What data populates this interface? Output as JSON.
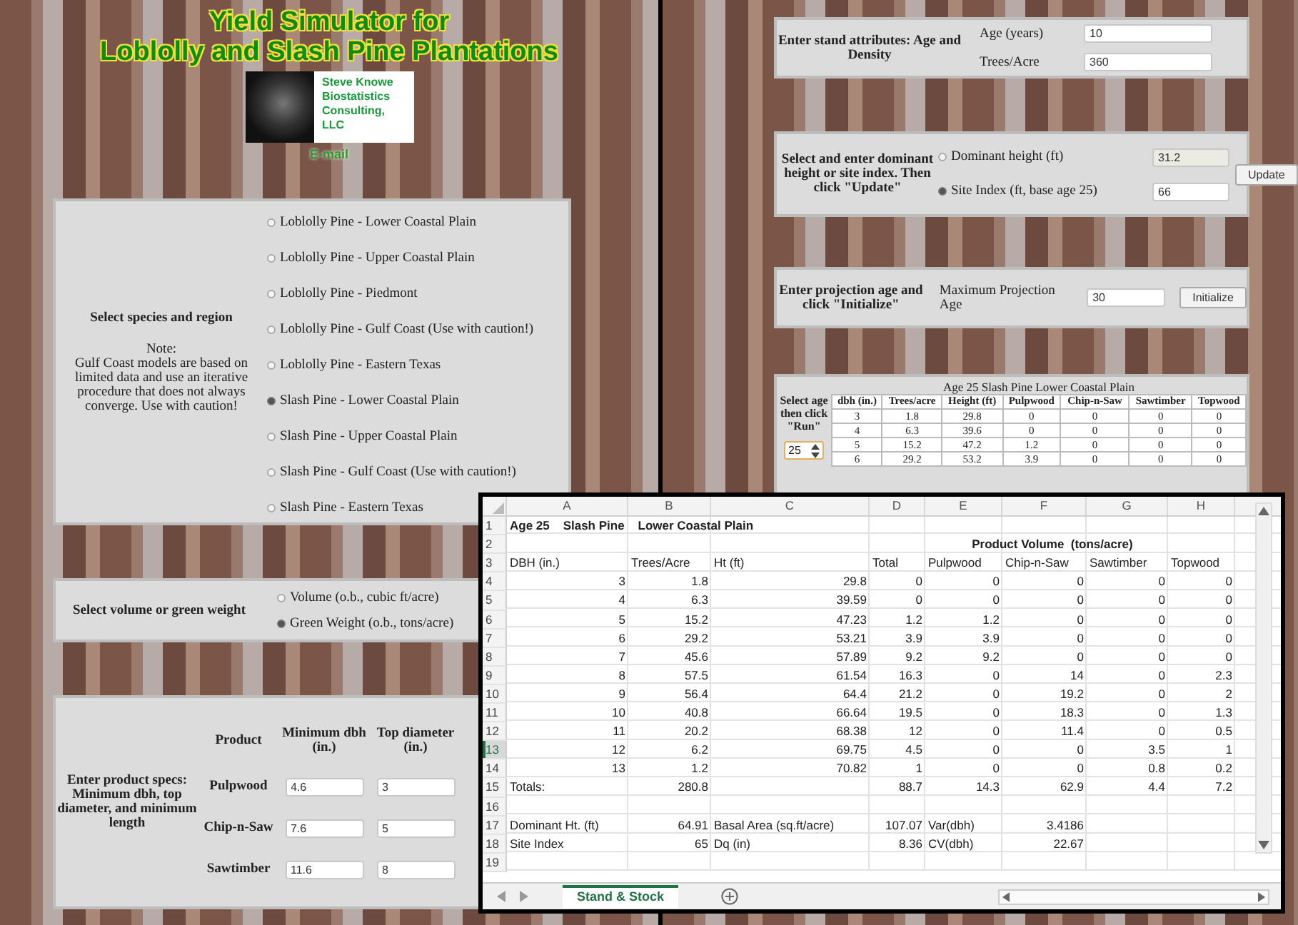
{
  "header": {
    "title_lines": [
      "Yield Simulator for",
      "Loblolly and Slash Pine Plantations"
    ],
    "logo_text": "Steve Knowe Biostatistics Consulting, LLC",
    "link": "E-mail"
  },
  "species": {
    "label": "Select species and region",
    "note_title": "Note:",
    "note": "Gulf Coast models are based on limited data and use an iterative procedure that does not always converge. Use with caution!",
    "options": [
      {
        "label": "Loblolly Pine - Lower Coastal Plain",
        "selected": false
      },
      {
        "label": "Loblolly Pine - Upper Coastal Plain",
        "selected": false
      },
      {
        "label": "Loblolly Pine - Piedmont",
        "selected": false
      },
      {
        "label": "Loblolly Pine - Gulf Coast (Use with caution!)",
        "selected": false
      },
      {
        "label": "Loblolly Pine - Eastern Texas",
        "selected": false
      },
      {
        "label": "Slash Pine - Lower Coastal Plain",
        "selected": true
      },
      {
        "label": "Slash Pine - Upper Coastal Plain",
        "selected": false
      },
      {
        "label": "Slash Pine - Gulf Coast (Use with caution!)",
        "selected": false
      },
      {
        "label": "Slash Pine - Eastern Texas",
        "selected": false
      }
    ]
  },
  "measure": {
    "label": "Select volume or green weight",
    "options": [
      {
        "label": "Volume (o.b., cubic ft/acre)",
        "selected": false
      },
      {
        "label": "Green Weight (o.b., tons/acre)",
        "selected": true
      }
    ]
  },
  "products": {
    "label": "Enter product specs: Minimum dbh, top diameter, and minimum length",
    "columns": [
      "Product",
      "Minimum dbh (in.)",
      "Top diameter (in.)"
    ],
    "rows": [
      {
        "name": "Pulpwood",
        "min_dbh": "4.6",
        "top_diameter": "3"
      },
      {
        "name": "Chip-n-Saw",
        "min_dbh": "7.6",
        "top_diameter": "5"
      },
      {
        "name": "Sawtimber",
        "min_dbh": "11.6",
        "top_diameter": "8"
      }
    ]
  },
  "stand": {
    "label": "Enter stand attributes: Age and Density",
    "fields": [
      {
        "label": "Age (years)",
        "value": "10"
      },
      {
        "label": "Trees/Acre",
        "value": "360"
      }
    ]
  },
  "site": {
    "label": "Select and enter dominant height or site index. Then click \"Update\"",
    "options": [
      {
        "label": "Dominant height (ft)",
        "value": "31.2",
        "selected": false
      },
      {
        "label": "Site Index (ft, base age 25)",
        "value": "66",
        "selected": true
      }
    ],
    "button": "Update"
  },
  "projection": {
    "label": "Enter projection age and click \"Initialize\"",
    "field_label": "Maximum Projection Age",
    "value": "30",
    "button": "Initialize"
  },
  "run": {
    "label": "Select age then click \"Run\"",
    "age": "25",
    "table_title": "Age 25 Slash Pine Lower Coastal Plain",
    "columns": [
      "dbh (in.)",
      "Trees/acre",
      "Height (ft)",
      "Pulpwood",
      "Chip-n-Saw",
      "Sawtimber",
      "Topwood"
    ],
    "rows": [
      [
        "3",
        "1.8",
        "29.8",
        "0",
        "0",
        "0",
        "0"
      ],
      [
        "4",
        "6.3",
        "39.6",
        "0",
        "0",
        "0",
        "0"
      ],
      [
        "5",
        "15.2",
        "47.2",
        "1.2",
        "0",
        "0",
        "0"
      ],
      [
        "6",
        "29.2",
        "53.2",
        "3.9",
        "0",
        "0",
        "0"
      ]
    ]
  },
  "spreadsheet": {
    "columns": [
      "A",
      "B",
      "C",
      "D",
      "E",
      "F",
      "G",
      "H"
    ],
    "rows": [
      {
        "number": "1",
        "selected": false,
        "cells": [
          {
            "kind": "title",
            "text": "Age 25    Slash Pine    Lower Coastal Plain"
          }
        ]
      },
      {
        "number": "2",
        "selected": false,
        "cells": [
          null,
          null,
          null,
          {
            "kind": "group",
            "text": "Product Volume  (tons/acre)"
          }
        ]
      },
      {
        "number": "3",
        "selected": false,
        "cells": [
          {
            "kind": "text",
            "text": "DBH (in.)"
          },
          {
            "kind": "text",
            "text": "Trees/Acre"
          },
          {
            "kind": "text",
            "text": "Ht (ft)"
          },
          {
            "kind": "text",
            "text": "Total"
          },
          {
            "kind": "text",
            "text": "Pulpwood"
          },
          {
            "kind": "text",
            "text": "Chip-n-Saw"
          },
          {
            "kind": "text",
            "text": "Sawtimber"
          },
          {
            "kind": "text",
            "text": "Topwood"
          }
        ]
      },
      {
        "number": "4",
        "selected": false,
        "values": [
          "3",
          "1.8",
          "29.8",
          "0",
          "0",
          "0",
          "0",
          "0"
        ]
      },
      {
        "number": "5",
        "selected": false,
        "values": [
          "4",
          "6.3",
          "39.59",
          "0",
          "0",
          "0",
          "0",
          "0"
        ]
      },
      {
        "number": "6",
        "selected": false,
        "values": [
          "5",
          "15.2",
          "47.23",
          "1.2",
          "1.2",
          "0",
          "0",
          "0"
        ]
      },
      {
        "number": "7",
        "selected": false,
        "values": [
          "6",
          "29.2",
          "53.21",
          "3.9",
          "3.9",
          "0",
          "0",
          "0"
        ]
      },
      {
        "number": "8",
        "selected": false,
        "values": [
          "7",
          "45.6",
          "57.89",
          "9.2",
          "9.2",
          "0",
          "0",
          "0"
        ]
      },
      {
        "number": "9",
        "selected": false,
        "values": [
          "8",
          "57.5",
          "61.54",
          "16.3",
          "0",
          "14",
          "0",
          "2.3"
        ]
      },
      {
        "number": "10",
        "selected": false,
        "values": [
          "9",
          "56.4",
          "64.4",
          "21.2",
          "0",
          "19.2",
          "0",
          "2"
        ]
      },
      {
        "number": "11",
        "selected": false,
        "values": [
          "10",
          "40.8",
          "66.64",
          "19.5",
          "0",
          "18.3",
          "0",
          "1.3"
        ]
      },
      {
        "number": "12",
        "selected": false,
        "values": [
          "11",
          "20.2",
          "68.38",
          "12",
          "0",
          "11.4",
          "0",
          "0.5"
        ]
      },
      {
        "number": "13",
        "selected": true,
        "values": [
          "12",
          "6.2",
          "69.75",
          "4.5",
          "0",
          "0",
          "3.5",
          "1"
        ]
      },
      {
        "number": "14",
        "selected": false,
        "values": [
          "13",
          "1.2",
          "70.82",
          "1",
          "0",
          "0",
          "0.8",
          "0.2"
        ]
      },
      {
        "number": "15",
        "selected": false,
        "cells": [
          {
            "kind": "text",
            "text": "Totals:"
          },
          {
            "kind": "number",
            "text": "280.8"
          },
          null,
          {
            "kind": "number",
            "text": "88.7"
          },
          {
            "kind": "number",
            "text": "14.3"
          },
          {
            "kind": "number",
            "text": "62.9"
          },
          {
            "kind": "number",
            "text": "4.4"
          },
          {
            "kind": "number",
            "text": "7.2"
          }
        ]
      },
      {
        "number": "16",
        "selected": false
      },
      {
        "number": "17",
        "selected": false,
        "cells": [
          {
            "kind": "text",
            "text": "Dominant Ht. (ft)"
          },
          {
            "kind": "number",
            "text": "64.91"
          },
          {
            "kind": "text",
            "text": "Basal Area (sq.ft/acre)"
          },
          {
            "kind": "number",
            "text": "107.07"
          },
          {
            "kind": "text",
            "text": "Var(dbh)"
          },
          {
            "kind": "number",
            "text": "3.4186"
          }
        ]
      },
      {
        "number": "18",
        "selected": false,
        "cells": [
          {
            "kind": "text",
            "text": "Site Index"
          },
          {
            "kind": "number",
            "text": "65"
          },
          {
            "kind": "text",
            "text": "Dq (in)"
          },
          {
            "kind": "number",
            "text": "8.36"
          },
          {
            "kind": "text",
            "text": "CV(dbh)"
          },
          {
            "kind": "number",
            "text": "22.67"
          }
        ]
      },
      {
        "number": "19",
        "selected": false
      }
    ],
    "sheets": [
      {
        "label": "Stand & Stock",
        "selected": true
      }
    ]
  }
}
